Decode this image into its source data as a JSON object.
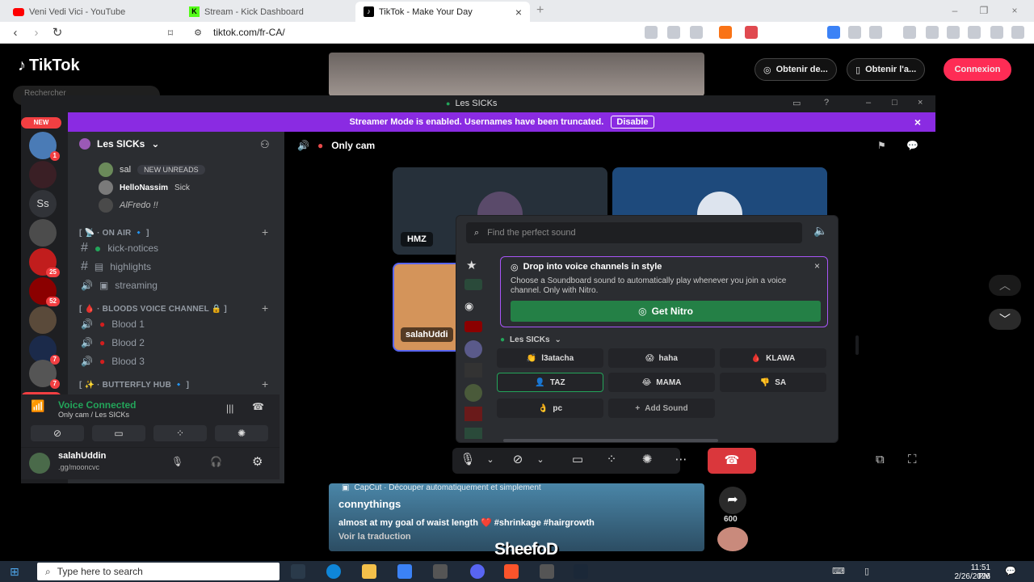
{
  "browser": {
    "tabs": [
      {
        "title": "Veni Vedi Vici - YouTube",
        "icon": "youtube-icon",
        "color": "#ff0000"
      },
      {
        "title": "Stream - Kick Dashboard",
        "icon": "kick-icon",
        "color": "#53fc18"
      },
      {
        "title": "TikTok - Make Your Day",
        "icon": "tiktok-icon",
        "color": "#000000"
      }
    ],
    "new_tab": "+",
    "close_glyph": "×",
    "url": "tiktok.com/fr-CA/",
    "window_controls": [
      "–",
      "❐",
      "×"
    ]
  },
  "tiktok": {
    "logo": "TikTok",
    "search_placeholder": "Rechercher",
    "new_badge": "NEW",
    "buttons": {
      "get_coins": "Obtenir de...",
      "get_app": "Obtenir l'a...",
      "login": "Connexion"
    },
    "login_color": "#fe2c55",
    "video": {
      "capcut_text": "CapCut · Découper automatiquement et simplement",
      "author": "connythings",
      "caption": "almost at my goal of waist length ❤️ #shrinkage #hairgrowth",
      "translate": "Voir la traduction",
      "share_count": "600"
    },
    "watermark": "SheefoD"
  },
  "discord": {
    "window_title": "Les SICKs",
    "streamer_banner": "Streamer Mode is enabled. Usernames have been truncated.",
    "disable_label": "Disable",
    "accent": "#8a2be2",
    "server_name": "Les SICKs",
    "guild_badges": [
      "1",
      "25",
      "52",
      "7",
      "7"
    ],
    "guild_new": "NEW",
    "members": [
      {
        "name": "sal",
        "extra": "NEW UNREADS"
      },
      {
        "name": "HelloNassim",
        "tag": "Sick"
      },
      {
        "name": "AlFredo !!"
      }
    ],
    "categories": [
      {
        "label": "[ 📡 · ON AIR 🔹 ]"
      },
      {
        "label": "[ 🩸 · BLOODS VOICE CHANNEL 🔒 ]"
      },
      {
        "label": "[ ✨ · BUTTERFLY HUB 🔹 ]"
      }
    ],
    "channels": [
      {
        "type": "text",
        "name": "kick-notices"
      },
      {
        "type": "text",
        "name": "highlights"
      },
      {
        "type": "voice",
        "name": "streaming"
      },
      {
        "type": "voice",
        "name": "Blood 1"
      },
      {
        "type": "voice",
        "name": "Blood 2"
      },
      {
        "type": "voice",
        "name": "Blood 3"
      }
    ],
    "voice_connected": {
      "status": "Voice Connected",
      "channel": "Only cam / Les SICKs",
      "color": "#23a55a"
    },
    "user": {
      "name": "salahUddin",
      "status": ".gg/moonсvc"
    },
    "header": {
      "channel": "Only cam"
    },
    "tiles": [
      {
        "name": "HMZ"
      },
      {
        "name": "salahUddi"
      }
    ],
    "soundboard": {
      "search_placeholder": "Find the perfect sound",
      "promo_title": "Drop into voice channels in style",
      "promo_body": "Choose a Soundboard sound to automatically play whenever you join a voice channel. Only with Nitro.",
      "get_nitro": "Get Nitro",
      "nitro_color": "#248046",
      "server_section": "Les SICKs",
      "sounds": [
        {
          "emoji": "👏",
          "name": "l3atacha"
        },
        {
          "emoji": "😱",
          "name": "haha"
        },
        {
          "emoji": "🩸",
          "name": "KLAWA"
        },
        {
          "emoji": "👤",
          "name": "TAZ"
        },
        {
          "emoji": "😂",
          "name": "MAMA"
        },
        {
          "emoji": "👎",
          "name": "SA"
        },
        {
          "emoji": "👌",
          "name": "pc"
        }
      ],
      "add_sound": "Add Sound"
    }
  },
  "taskbar": {
    "search_placeholder": "Type here to search",
    "time": "11:51 PM",
    "date": "2/26/2026"
  }
}
